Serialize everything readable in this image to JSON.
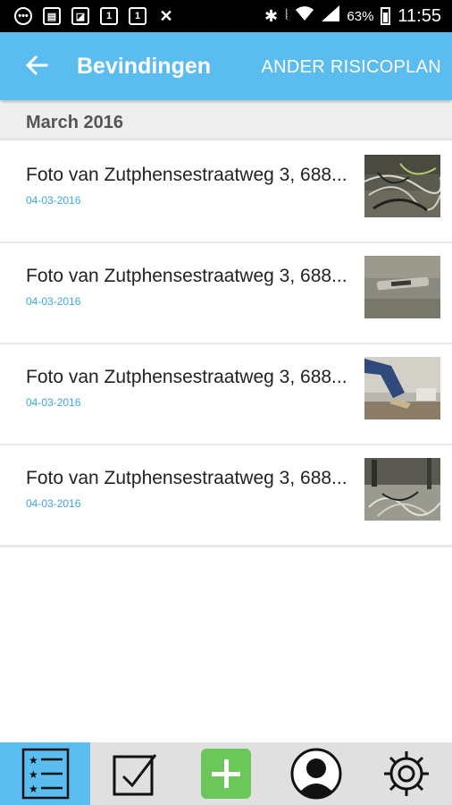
{
  "status_bar": {
    "battery_percent": "63%",
    "time": "11:55",
    "notification_icons": [
      "chat-icon",
      "image-icon",
      "gallery-icon",
      "sim-1-icon",
      "sim-1-icon",
      "shuffle-icon"
    ]
  },
  "app_bar": {
    "title": "Bevindingen",
    "action_label": "ANDER RISICOPLAN",
    "background": "#5bbcf0"
  },
  "section": {
    "header": "March 2016"
  },
  "items": [
    {
      "title": "Foto van Zutphensestraatweg 3, 688...",
      "date": "04-03-2016",
      "thumbnail": "cables-photo"
    },
    {
      "title": "Foto van Zutphensestraatweg 3, 688...",
      "date": "04-03-2016",
      "thumbnail": "device-photo"
    },
    {
      "title": "Foto van Zutphensestraatweg 3, 688...",
      "date": "04-03-2016",
      "thumbnail": "person-legs-photo"
    },
    {
      "title": "Foto van Zutphensestraatweg 3, 688...",
      "date": "04-03-2016",
      "thumbnail": "desk-cables-photo"
    }
  ],
  "bottom_nav": {
    "tabs": [
      "checklist-icon",
      "checkbox-icon",
      "add-icon",
      "profile-icon",
      "settings-icon"
    ],
    "active_tab": "checklist-icon"
  }
}
